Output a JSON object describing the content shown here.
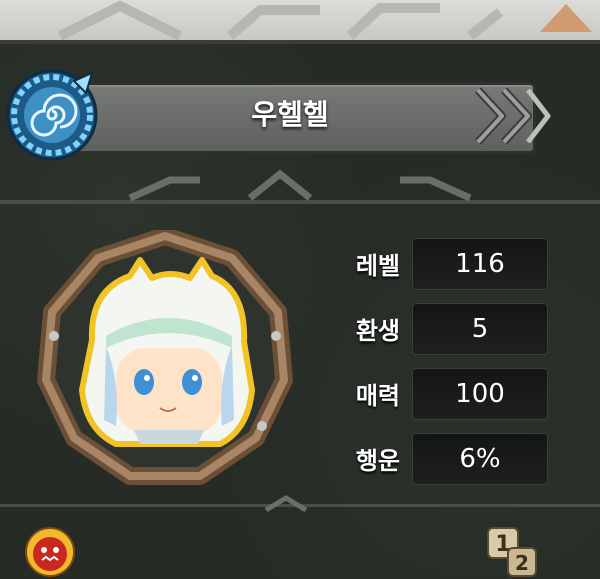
{
  "character": {
    "name": "우헬헬"
  },
  "stats": [
    {
      "label": "레벨",
      "value": "116"
    },
    {
      "label": "환생",
      "value": "5"
    },
    {
      "label": "매력",
      "value": "100"
    },
    {
      "label": "행운",
      "value": "6%"
    }
  ],
  "icons": {
    "emblem": "spiral-emblem-icon",
    "chevron": "double-chevron-right-icon",
    "badge": "red-monster-badge-icon",
    "page": "page-1-2-icon"
  },
  "colors": {
    "panel_bg": "#262b26",
    "name_bar": "#6b6e6a",
    "emblem_blue": "#4fb4e6",
    "frame_wood": "#8c6a4a",
    "badge_red": "#c8281e"
  }
}
